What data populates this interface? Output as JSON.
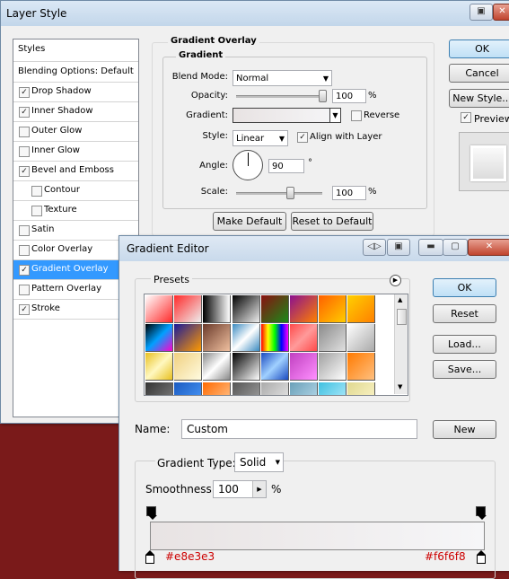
{
  "layer_style": {
    "title": "Layer Style",
    "styles_header": "Styles",
    "blending_options": "Blending Options: Default",
    "items": [
      {
        "label": "Drop Shadow",
        "checked": true,
        "indent": false
      },
      {
        "label": "Inner Shadow",
        "checked": true,
        "indent": false
      },
      {
        "label": "Outer Glow",
        "checked": false,
        "indent": false
      },
      {
        "label": "Inner Glow",
        "checked": false,
        "indent": false
      },
      {
        "label": "Bevel and Emboss",
        "checked": true,
        "indent": false
      },
      {
        "label": "Contour",
        "checked": false,
        "indent": true
      },
      {
        "label": "Texture",
        "checked": false,
        "indent": true
      },
      {
        "label": "Satin",
        "checked": false,
        "indent": false
      },
      {
        "label": "Color Overlay",
        "checked": false,
        "indent": false
      },
      {
        "label": "Gradient Overlay",
        "checked": true,
        "indent": false,
        "selected": true
      },
      {
        "label": "Pattern Overlay",
        "checked": false,
        "indent": false
      },
      {
        "label": "Stroke",
        "checked": true,
        "indent": false
      }
    ],
    "ok": "OK",
    "cancel": "Cancel",
    "new_style": "New Style...",
    "preview": "Preview",
    "preview_checked": true,
    "overlay": {
      "section_title": "Gradient Overlay",
      "group_title": "Gradient",
      "blend_mode_label": "Blend Mode:",
      "blend_mode_value": "Normal",
      "opacity_label": "Opacity:",
      "opacity_value": "100",
      "pct": "%",
      "gradient_label": "Gradient:",
      "reverse_label": "Reverse",
      "reverse_checked": false,
      "style_label": "Style:",
      "style_value": "Linear",
      "align_label": "Align with Layer",
      "align_checked": true,
      "angle_label": "Angle:",
      "angle_value": "90",
      "degree": "°",
      "scale_label": "Scale:",
      "scale_value": "100",
      "make_default": "Make Default",
      "reset_default": "Reset to Default"
    }
  },
  "gradient_editor": {
    "title": "Gradient Editor",
    "presets_label": "Presets",
    "ok": "OK",
    "reset": "Reset",
    "load": "Load...",
    "save": "Save...",
    "name_label": "Name:",
    "name_value": "Custom",
    "new": "New",
    "type_label": "Gradient Type:",
    "type_value": "Solid",
    "smoothness_label": "Smoothness:",
    "smoothness_value": "100",
    "pct": "%",
    "stop_left_color": "#e8e3e3",
    "stop_right_color": "#f6f6f8",
    "annotation_color": "#cc0000",
    "preset_rows": [
      [
        "#ff2a2a",
        "#e02020",
        "#000000",
        "#111111",
        "#7a1010",
        "#5a1040",
        "#ff7a00",
        "#ffd000"
      ],
      [
        "#6a1fa0",
        "#2a2a8a",
        "#c08a70",
        "#3a8ac0",
        "#ff00cc",
        "#ff4a4a",
        "#9a9a9a",
        "#e8e8e8"
      ],
      [
        "#e8c020",
        "#f0d080",
        "#b0b0b0",
        "#1a1a1a",
        "#4a8ae8",
        "#a040c0",
        "#cfcfcf",
        "#ff8a20"
      ],
      [
        "#4a4a4a",
        "#2a6ad0",
        "#ff7a20",
        "#6a6a6a",
        "#c0c0c0",
        "#7ab0c8",
        "#60d0e8",
        "#e8e0a0"
      ]
    ],
    "preset_gradients": [
      [
        "linear-gradient(135deg,#fff,#ff2a2a)",
        "linear-gradient(135deg,#ff2a2a,#eee)",
        "linear-gradient(90deg,#000,#fff)",
        "linear-gradient(135deg,#000,#eee)",
        "linear-gradient(135deg,#8a1010,#1a8a1a)",
        "linear-gradient(135deg,#8a1090,#ff8000)",
        "linear-gradient(135deg,#ff6000,#ffcc00)",
        "linear-gradient(135deg,#ffd000,#ff8000)"
      ],
      [
        "linear-gradient(135deg,#000,#00a0ff,#ff00cc)",
        "linear-gradient(135deg,#1a1a9a,#ff9a00)",
        "linear-gradient(135deg,#6a3a2a,#f0c0a0)",
        "linear-gradient(135deg,#3a8ac0,#fff,#3a8ac0)",
        "linear-gradient(90deg,#ff0000,#ffff00,#00ff00,#0000ff,#ff00ff)",
        "linear-gradient(135deg,#ff4a4a,#ff9a9a,#ff4a4a)",
        "linear-gradient(135deg,#8a8a8a,#e0e0e0)",
        "linear-gradient(135deg,#fff,#aaa)"
      ],
      [
        "linear-gradient(135deg,#e8c020,#fff8c0,#e8c020)",
        "linear-gradient(135deg,#f0d080,#fffbe0)",
        "linear-gradient(135deg,#888,#fff,#888)",
        "linear-gradient(135deg,#000,#fff)",
        "linear-gradient(135deg,#1a4ac0,#a0d0ff,#1a4ac0)",
        "linear-gradient(135deg,#c040c0,#ff90ff)",
        "linear-gradient(135deg,#a0a0a0,#ffffff)",
        "linear-gradient(135deg,#ff7a00,#ffc080)"
      ],
      [
        "linear-gradient(135deg,#333,#888)",
        "linear-gradient(135deg,#1a5ac0,#50a0ff)",
        "linear-gradient(135deg,#ff6a00,#ffd0a0)",
        "linear-gradient(135deg,#555,#aaa)",
        "linear-gradient(135deg,#aaa,#eee)",
        "linear-gradient(135deg,#6aa0b8,#c0e0f0)",
        "linear-gradient(135deg,#40c0e0,#c0f0ff)",
        "linear-gradient(135deg,#e0d890,#fff8d0)"
      ]
    ]
  }
}
